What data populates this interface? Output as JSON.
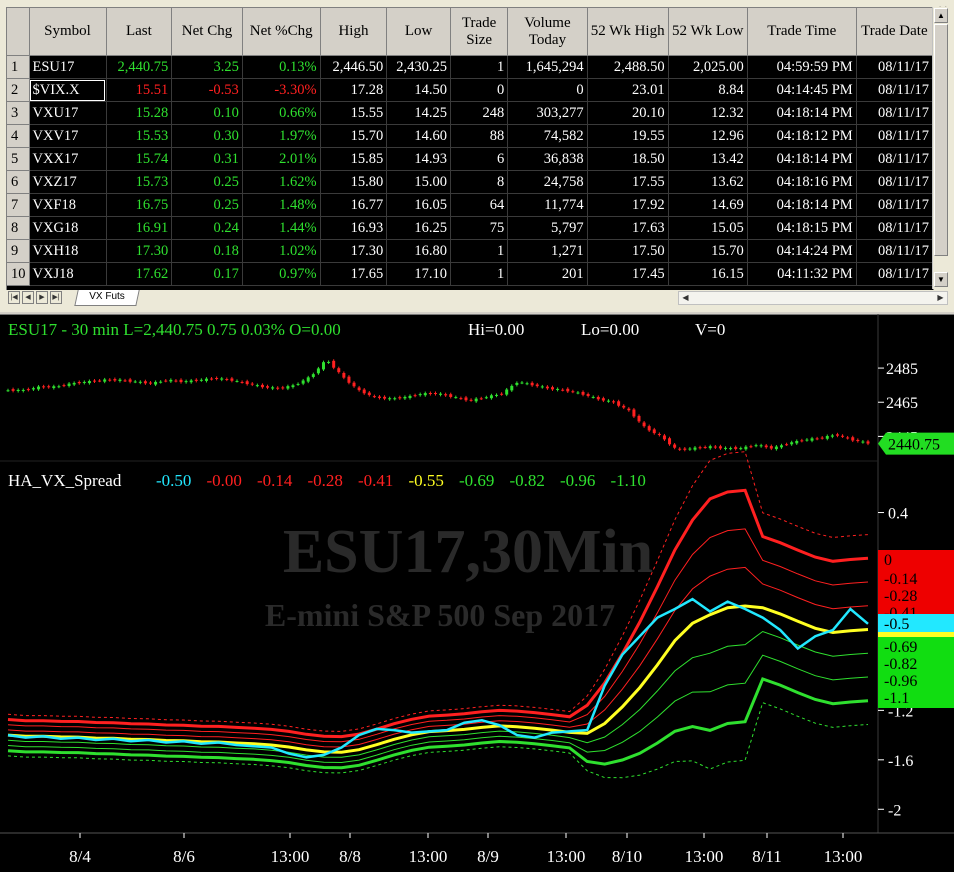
{
  "quote_board": {
    "columns": [
      "Symbol",
      "Last",
      "Net Chg",
      "Net %Chg",
      "High",
      "Low",
      "Trade Size",
      "Volume Today",
      "52 Wk High",
      "52 Wk Low",
      "Trade Time",
      "Trade Date"
    ],
    "rows": [
      {
        "n": "1",
        "symbol": "ESU17",
        "last": "2,440.75",
        "chg": "3.25",
        "pct": "0.13%",
        "high": "2,446.50",
        "low": "2,430.25",
        "size": "1",
        "volume": "1,645,294",
        "wkhigh": "2,488.50",
        "wklow": "2,025.00",
        "time": "04:59:59 PM",
        "date": "08/11/17",
        "dir": "up"
      },
      {
        "n": "2",
        "symbol": "$VIX.X",
        "last": "15.51",
        "chg": "-0.53",
        "pct": "-3.30%",
        "high": "17.28",
        "low": "14.50",
        "size": "0",
        "volume": "0",
        "wkhigh": "23.01",
        "wklow": "8.84",
        "time": "04:14:45 PM",
        "date": "08/11/17",
        "dir": "down"
      },
      {
        "n": "3",
        "symbol": "VXU17",
        "last": "15.28",
        "chg": "0.10",
        "pct": "0.66%",
        "high": "15.55",
        "low": "14.25",
        "size": "248",
        "volume": "303,277",
        "wkhigh": "20.10",
        "wklow": "12.32",
        "time": "04:18:14 PM",
        "date": "08/11/17",
        "dir": "up"
      },
      {
        "n": "4",
        "symbol": "VXV17",
        "last": "15.53",
        "chg": "0.30",
        "pct": "1.97%",
        "high": "15.70",
        "low": "14.60",
        "size": "88",
        "volume": "74,582",
        "wkhigh": "19.55",
        "wklow": "12.96",
        "time": "04:18:12 PM",
        "date": "08/11/17",
        "dir": "up"
      },
      {
        "n": "5",
        "symbol": "VXX17",
        "last": "15.74",
        "chg": "0.31",
        "pct": "2.01%",
        "high": "15.85",
        "low": "14.93",
        "size": "6",
        "volume": "36,838",
        "wkhigh": "18.50",
        "wklow": "13.42",
        "time": "04:18:14 PM",
        "date": "08/11/17",
        "dir": "up"
      },
      {
        "n": "6",
        "symbol": "VXZ17",
        "last": "15.73",
        "chg": "0.25",
        "pct": "1.62%",
        "high": "15.80",
        "low": "15.00",
        "size": "8",
        "volume": "24,758",
        "wkhigh": "17.55",
        "wklow": "13.62",
        "time": "04:18:16 PM",
        "date": "08/11/17",
        "dir": "up"
      },
      {
        "n": "7",
        "symbol": "VXF18",
        "last": "16.75",
        "chg": "0.25",
        "pct": "1.48%",
        "high": "16.77",
        "low": "16.05",
        "size": "64",
        "volume": "11,774",
        "wkhigh": "17.92",
        "wklow": "14.69",
        "time": "04:18:14 PM",
        "date": "08/11/17",
        "dir": "up"
      },
      {
        "n": "8",
        "symbol": "VXG18",
        "last": "16.91",
        "chg": "0.24",
        "pct": "1.44%",
        "high": "16.93",
        "low": "16.25",
        "size": "75",
        "volume": "5,797",
        "wkhigh": "17.63",
        "wklow": "15.05",
        "time": "04:18:15 PM",
        "date": "08/11/17",
        "dir": "up"
      },
      {
        "n": "9",
        "symbol": "VXH18",
        "last": "17.30",
        "chg": "0.18",
        "pct": "1.02%",
        "high": "17.30",
        "low": "16.80",
        "size": "1",
        "volume": "1,271",
        "wkhigh": "17.50",
        "wklow": "15.70",
        "time": "04:14:24 PM",
        "date": "08/11/17",
        "dir": "up"
      },
      {
        "n": "10",
        "symbol": "VXJ18",
        "last": "17.62",
        "chg": "0.17",
        "pct": "0.97%",
        "high": "17.65",
        "low": "17.10",
        "size": "1",
        "volume": "201",
        "wkhigh": "17.45",
        "wklow": "16.15",
        "time": "04:11:32 PM",
        "date": "08/11/17",
        "dir": "up"
      }
    ],
    "sheet_tab": "VX Futs",
    "close_glyph": "✕"
  },
  "colors": {
    "up": "#2fe02f",
    "down": "#ff2020",
    "cyan": "#22e8ff",
    "yellow": "#ffff22",
    "grid_bg": "#000000"
  },
  "chart": {
    "price_header": "ESU17 - 30 min  L=2,440.75  0.75  0.03%  O=0.00",
    "hi_label": "Hi=0.00",
    "lo_label": "Lo=0.00",
    "vol_label": "V=0",
    "price_axis": [
      "2485",
      "2465",
      "2445"
    ],
    "price_tag": "2440.75",
    "indicator_name": "HA_VX_Spread",
    "indicator_values": [
      {
        "v": "-0.50",
        "c": "cyan"
      },
      {
        "v": "-0.00",
        "c": "down"
      },
      {
        "v": "-0.14",
        "c": "down"
      },
      {
        "v": "-0.28",
        "c": "down"
      },
      {
        "v": "-0.41",
        "c": "down"
      },
      {
        "v": "-0.55",
        "c": "yellow"
      },
      {
        "v": "-0.69",
        "c": "up"
      },
      {
        "v": "-0.82",
        "c": "up"
      },
      {
        "v": "-0.96",
        "c": "up"
      },
      {
        "v": "-1.10",
        "c": "up"
      }
    ],
    "indicator_axis": [
      "0.4",
      "-1.2",
      "-1.6",
      "-2"
    ],
    "indicator_tags": [
      {
        "v": "0",
        "c": "down"
      },
      {
        "v": "-0.14",
        "c": "down"
      },
      {
        "v": "-0.28",
        "c": "down"
      },
      {
        "v": "-0.41",
        "c": "down"
      },
      {
        "v": "-0.5",
        "c": "cyan"
      },
      {
        "v": "-0.69",
        "c": "up"
      },
      {
        "v": "-0.82",
        "c": "up"
      },
      {
        "v": "-0.96",
        "c": "up"
      },
      {
        "v": "-1.1",
        "c": "up"
      }
    ],
    "watermark_symbol": "ESU17,30Min",
    "watermark_desc": "E-mini S&P 500 Sep 2017",
    "time_labels": [
      "8/4",
      "8/6",
      "13:00",
      "8/8",
      "13:00",
      "8/9",
      "13:00",
      "8/10",
      "13:00",
      "8/11",
      "13:00"
    ]
  },
  "chart_data": {
    "type": "line",
    "title": "ESU17 - 30 min",
    "subtitle": "E-mini S&P 500 Sep 2017",
    "x_labels": [
      "8/4",
      "8/6",
      "13:00",
      "8/8",
      "13:00",
      "8/9",
      "13:00",
      "8/10",
      "13:00",
      "8/11",
      "13:00"
    ],
    "price_series": {
      "name": "ESU17",
      "last": 2440.75,
      "ylim": [
        2430,
        2495
      ],
      "approx_path": [
        2472,
        2472,
        2474,
        2474,
        2476,
        2477,
        2478,
        2478,
        2477,
        2476,
        2478,
        2477,
        2478,
        2479,
        2478,
        2476,
        2474,
        2473,
        2475,
        2480,
        2490,
        2480,
        2472,
        2468,
        2467,
        2468,
        2470,
        2470,
        2468,
        2466,
        2468,
        2470,
        2477,
        2475,
        2473,
        2472,
        2470,
        2467,
        2465,
        2460,
        2450,
        2445,
        2437,
        2438,
        2439,
        2438,
        2438,
        2440,
        2438,
        2441,
        2443,
        2444,
        2446,
        2443,
        2441
      ]
    },
    "indicator": {
      "name": "HA_VX_Spread",
      "ylim": [
        -2.2,
        0.55
      ],
      "levels": [
        -0.5,
        -0.0,
        -0.14,
        -0.28,
        -0.41,
        -0.55,
        -0.69,
        -0.82,
        -0.96,
        -1.1
      ]
    },
    "series": [
      {
        "name": "HA_VX_Spread",
        "values": [
          -1.4,
          -1.42,
          -1.41,
          -1.43,
          -1.42,
          -1.44,
          -1.43,
          -1.45,
          -1.44,
          -1.46,
          -1.45,
          -1.47,
          -1.46,
          -1.48,
          -1.49,
          -1.5,
          -1.55,
          -1.58,
          -1.56,
          -1.5,
          -1.4,
          -1.35,
          -1.36,
          -1.38,
          -1.37,
          -1.36,
          -1.3,
          -1.28,
          -1.32,
          -1.4,
          -1.42,
          -1.38,
          -1.37,
          -1.36,
          -1.0,
          -0.75,
          -0.6,
          -0.45,
          -0.38,
          -0.3,
          -0.4,
          -0.32,
          -0.38,
          -0.45,
          -0.55,
          -0.7,
          -0.6,
          -0.55,
          -0.38,
          -0.5
        ]
      }
    ]
  }
}
